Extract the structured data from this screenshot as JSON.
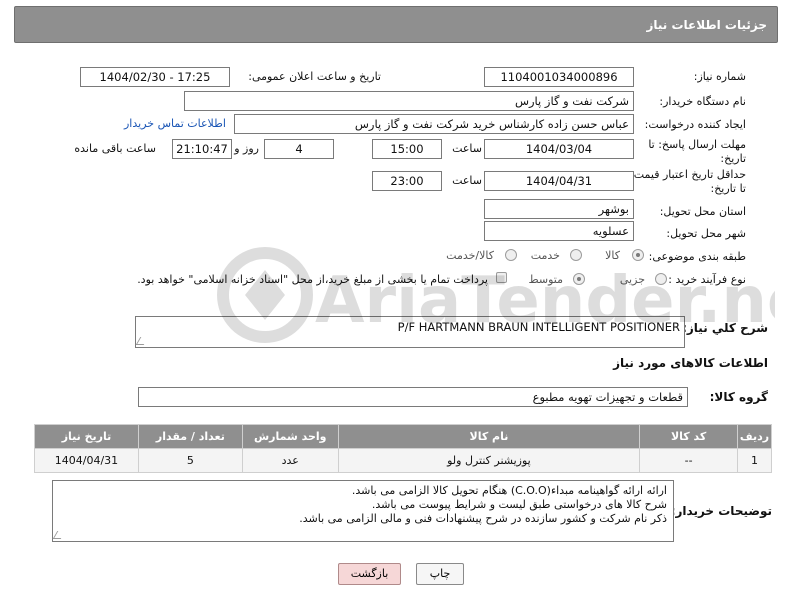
{
  "header": {
    "title": "جزئیات اطلاعات نیاز"
  },
  "form": {
    "need_number": {
      "label": "شماره نیاز:",
      "value": "1104001034000896"
    },
    "announce_datetime": {
      "label": "تاریخ و ساعت اعلان عمومی:",
      "value": "1404/02/30 - 17:25"
    },
    "buyer_org": {
      "label": "نام دستگاه خریدار:",
      "value": "شرکت نفت و گاز پارس"
    },
    "requester": {
      "label": "ایجاد کننده درخواست:",
      "value": "عباس حسن زاده کارشناس خرید شرکت نفت و گاز پارس",
      "contact_link": "اطلاعات تماس خریدار"
    },
    "response_deadline": {
      "label": "مهلت ارسال پاسخ: تا تاریخ:",
      "date": "1404/03/04",
      "time_label": "ساعت",
      "time": "15:00",
      "days": "4",
      "days_label": "روز و",
      "remaining": "21:10:47",
      "remaining_label": "ساعت باقی مانده"
    },
    "price_validity": {
      "label": "حداقل تاریخ اعتبار قیمت: تا تاریخ:",
      "date": "1404/04/31",
      "time_label": "ساعت",
      "time": "23:00"
    },
    "delivery_province": {
      "label": "استان محل تحویل:",
      "value": "بوشهر"
    },
    "delivery_city": {
      "label": "شهر محل تحویل:",
      "value": "عسلویه"
    },
    "category": {
      "label": "طبقه بندی موضوعی:",
      "options": [
        "کالا",
        "خدمت",
        "کالا/خدمت"
      ],
      "selected": "کالا"
    },
    "purchase_type": {
      "label": "نوع فرآیند خرید :",
      "options": [
        "جزیی",
        "متوسط"
      ],
      "selected": "متوسط",
      "payment_note": "پرداخت تمام یا بخشی از مبلغ خرید،از محل \"اسناد خزانه اسلامی\" خواهد بود."
    }
  },
  "description": {
    "label": "شرح كلي نياز:",
    "value": "P/F HARTMANN BRAUN INTELLIGENT POSITIONER"
  },
  "goods_info": {
    "title": "اطلاعات کالاهای مورد نیاز",
    "group_label": "گروه کالا:",
    "group_value": "قطعات و تجهیزات تهویه مطبوع"
  },
  "table": {
    "headers": [
      "ردیف",
      "کد کالا",
      "نام کالا",
      "واحد شمارش",
      "تعداد / مقدار",
      "تاریخ نیاز"
    ],
    "rows": [
      [
        "1",
        "--",
        "پوزیشنر کنترل ولو",
        "عدد",
        "5",
        "1404/04/31"
      ]
    ]
  },
  "buyer_notes": {
    "label": "توضیحات خریدار:",
    "lines": [
      "ارائه ارائه گواهینامه مبداء(C.O.O) هنگام تحویل کالا الزامی می باشد.",
      "شرح کالا های درخواستی طبق لیست و شرایط پیوست می باشد.",
      "ذکر نام شرکت و کشور سازنده در شرح پیشنهادات فنی و مالی الزامی می باشد."
    ]
  },
  "buttons": {
    "print": "چاپ",
    "back": "بازگشت"
  },
  "watermark": {
    "text": "AriaTender.neT"
  }
}
